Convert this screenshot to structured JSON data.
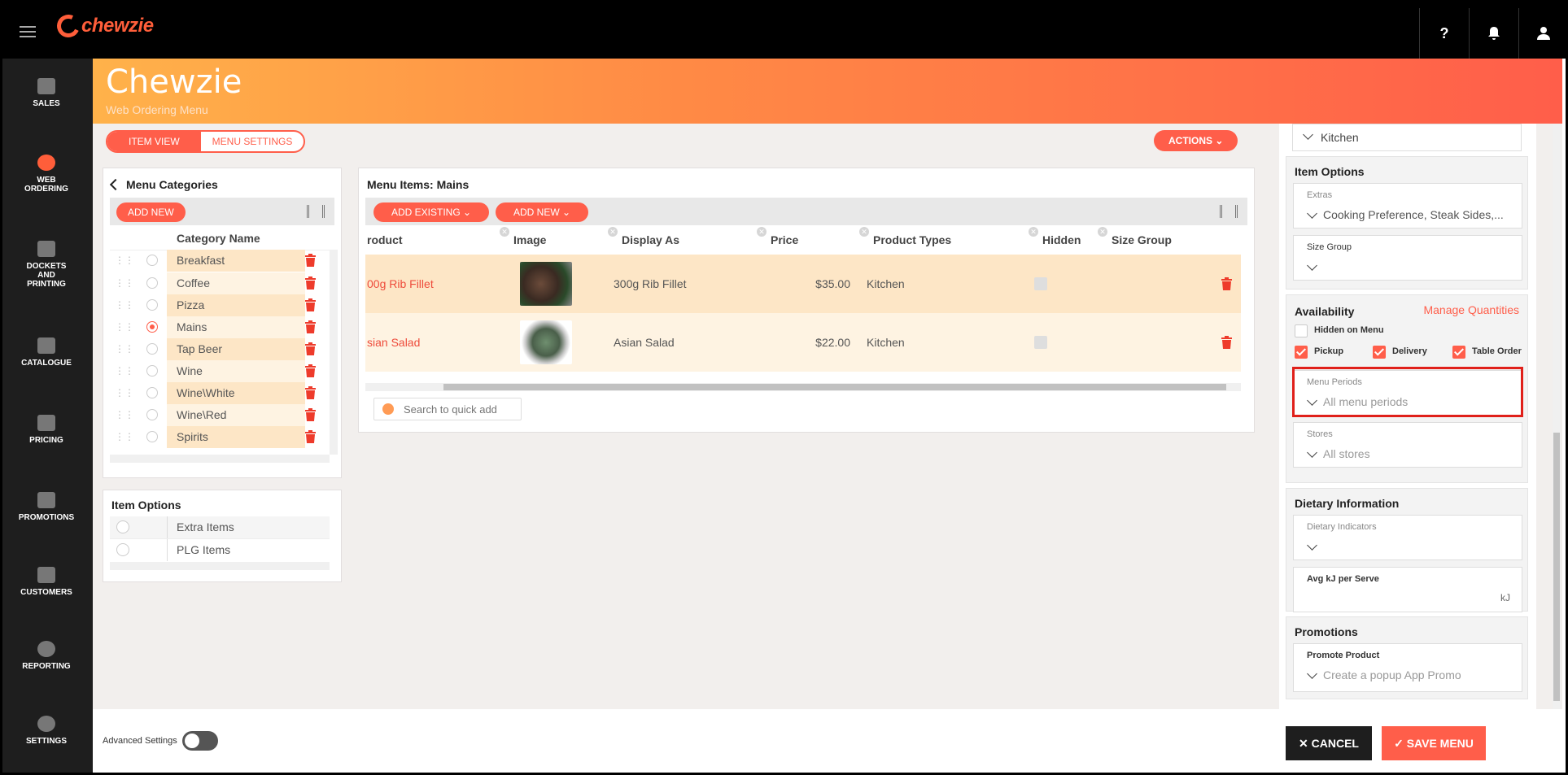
{
  "app": {
    "brand": "chewzie",
    "title": "Chewzie",
    "subtitle": "Web Ordering Menu"
  },
  "topbar": {
    "help_label": "?",
    "icons": [
      "help-icon",
      "bell-icon",
      "user-icon"
    ]
  },
  "sidebar": {
    "items": [
      {
        "label": "SALES",
        "icon": "sales-icon"
      },
      {
        "label": "WEB ORDERING",
        "icon": "globe-icon",
        "active": true
      },
      {
        "label": "DOCKETS AND PRINTING",
        "icon": "printer-icon"
      },
      {
        "label": "CATALOGUE",
        "icon": "catalogue-icon"
      },
      {
        "label": "PRICING",
        "icon": "tag-icon"
      },
      {
        "label": "PROMOTIONS",
        "icon": "megaphone-icon"
      },
      {
        "label": "CUSTOMERS",
        "icon": "users-icon"
      },
      {
        "label": "REPORTING",
        "icon": "pie-chart-icon"
      },
      {
        "label": "SETTINGS",
        "icon": "gear-icon"
      }
    ]
  },
  "toolbar": {
    "item_view": "ITEM VIEW",
    "menu_settings": "MENU SETTINGS",
    "actions": "ACTIONS"
  },
  "categories": {
    "title": "Menu Categories",
    "add_new": "ADD NEW",
    "column_header": "Category Name",
    "rows": [
      {
        "name": "Breakfast",
        "selected": false
      },
      {
        "name": "Coffee",
        "selected": false
      },
      {
        "name": "Pizza",
        "selected": false
      },
      {
        "name": "Mains",
        "selected": true
      },
      {
        "name": "Tap Beer",
        "selected": false
      },
      {
        "name": "Wine",
        "selected": false
      },
      {
        "name": "Wine\\White",
        "selected": false
      },
      {
        "name": "Wine\\Red",
        "selected": false
      },
      {
        "name": "Spirits",
        "selected": false
      }
    ]
  },
  "item_options_panel": {
    "title": "Item Options",
    "rows": [
      "Extra Items",
      "PLG Items"
    ]
  },
  "menu_items": {
    "title": "Menu Items: Mains",
    "add_existing": "ADD EXISTING",
    "add_new": "ADD NEW",
    "columns": [
      "roduct",
      "Image",
      "Display As",
      "Price",
      "Product Types",
      "Hidden",
      "Size Group"
    ],
    "rows": [
      {
        "product": "00g Rib Fillet",
        "display_as": "300g Rib Fillet",
        "price": "$35.00",
        "product_types": "Kitchen",
        "hidden": false
      },
      {
        "product": "sian Salad",
        "display_as": "Asian Salad",
        "price": "$22.00",
        "product_types": "Kitchen",
        "hidden": false
      }
    ],
    "search_placeholder": "Search to quick add"
  },
  "right_panel": {
    "kitchen_value": "Kitchen",
    "item_options": {
      "title": "Item Options",
      "extras_label": "Extras",
      "extras_value": "Cooking Preference, Steak Sides,...",
      "size_group_label": "Size Group",
      "size_group_value": ""
    },
    "availability": {
      "title": "Availability",
      "manage_link": "Manage Quantities",
      "hidden_on_menu": "Hidden on Menu",
      "pickup": "Pickup",
      "delivery": "Delivery",
      "table_order": "Table Order",
      "menu_periods_label": "Menu Periods",
      "menu_periods_value": "All menu periods",
      "stores_label": "Stores",
      "stores_value": "All stores"
    },
    "dietary": {
      "title": "Dietary Information",
      "indicators_label": "Dietary Indicators",
      "avg_kj_label": "Avg kJ per Serve",
      "unit": "kJ"
    },
    "promotions": {
      "title": "Promotions",
      "promote_label": "Promote Product",
      "promote_placeholder": "Create a popup App Promo"
    }
  },
  "footer": {
    "advanced_settings": "Advanced Settings",
    "cancel": "CANCEL",
    "save": "SAVE MENU"
  }
}
